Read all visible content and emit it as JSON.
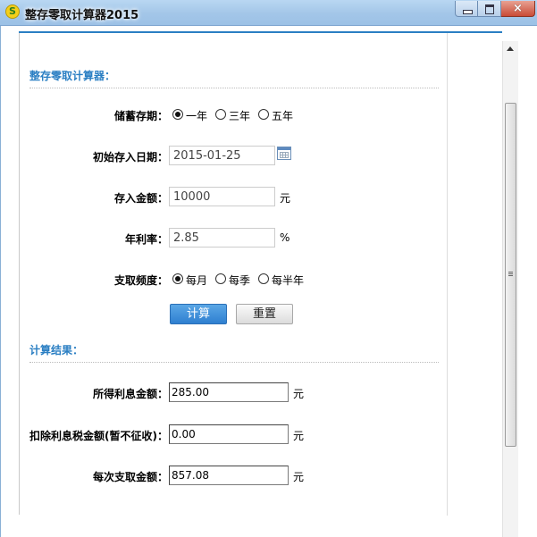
{
  "window": {
    "title": "整存零取计算器2015",
    "app_icon": "S",
    "close_glyph": "×"
  },
  "calculator": {
    "section_title": "整存零取计算器：",
    "term": {
      "label": "储蓄存期：",
      "options": [
        "一年",
        "三年",
        "五年"
      ],
      "selected": "一年"
    },
    "start_date": {
      "label": "初始存入日期：",
      "value": "2015-01-25"
    },
    "deposit_amount": {
      "label": "存入金额：",
      "value": "10000",
      "unit": "元"
    },
    "annual_rate": {
      "label": "年利率：",
      "value": "2.85",
      "unit": "%"
    },
    "frequency": {
      "label": "支取频度：",
      "options": [
        "每月",
        "每季",
        "每半年"
      ],
      "selected": "每月"
    },
    "calc_button": "计算",
    "reset_button": "重置"
  },
  "results": {
    "section_title": "计算结果：",
    "interest": {
      "label": "所得利息金额：",
      "value": "285.00",
      "unit": "元"
    },
    "after_tax": {
      "label": "扣除利息税金额(暂不征收)：",
      "value": "0.00",
      "unit": "元"
    },
    "withdrawal": {
      "label": "每次支取金额：",
      "value": "857.08",
      "unit": "元"
    }
  },
  "colors": {
    "accent": "#2b7fc3",
    "titlebar": "#a3c6e8",
    "primary_button": "#3d8bd8"
  }
}
